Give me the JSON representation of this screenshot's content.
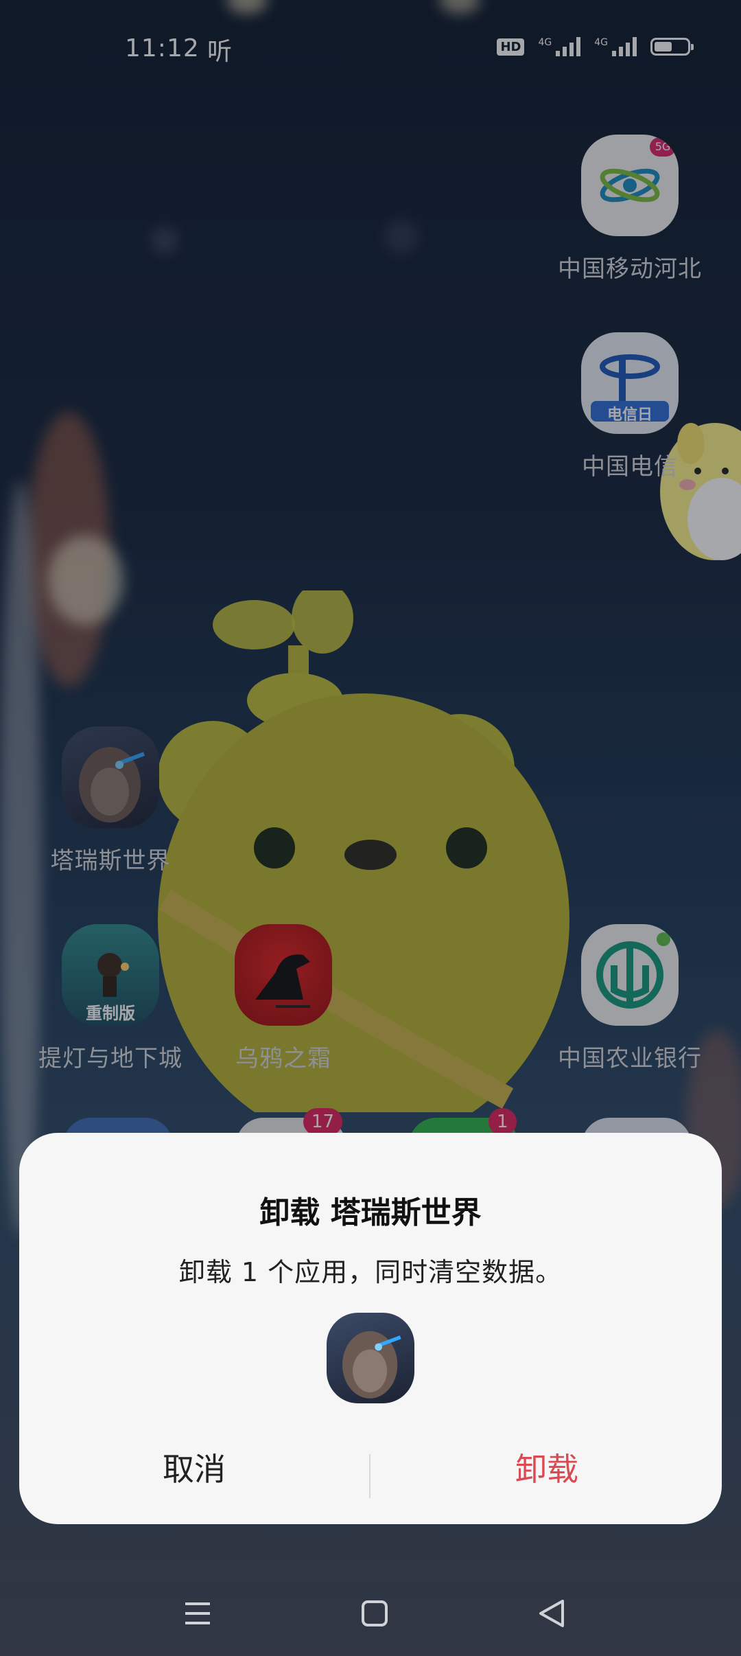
{
  "status_bar": {
    "time": "11:12",
    "extra_app_indicator": "听",
    "hd_label": "HD",
    "signal_1_label": "4G",
    "signal_2_label": "4G",
    "battery_level": 0.55
  },
  "home_apps": [
    {
      "label": "中国移动河北",
      "icon": "china-mobile-icon",
      "badge": "5G"
    },
    {
      "label": "中国电信",
      "icon": "china-telecom-icon",
      "icon_text": "电信日"
    },
    {
      "label": "塔瑞斯世界",
      "icon": "tarisland-icon"
    },
    {
      "label": "提灯与地下城",
      "icon": "lantern-dungeon-icon",
      "icon_text": "重制版"
    },
    {
      "label": "乌鸦之霜",
      "icon": "crow-frost-icon"
    },
    {
      "label": "中国农业银行",
      "icon": "abc-bank-icon"
    }
  ],
  "partial_row": {
    "badges": [
      "17",
      "1"
    ]
  },
  "dialog": {
    "title": "卸载 塔瑞斯世界",
    "message": "卸载 1 个应用，同时清空数据。",
    "app_icon": "tarisland-icon",
    "cancel_label": "取消",
    "confirm_label": "卸载"
  },
  "nav_bar": {
    "menu_icon": "menu-icon",
    "home_icon": "home-icon",
    "back_icon": "back-icon"
  },
  "colors": {
    "confirm": "#d94a52",
    "dialog_bg": "#f6f6f7"
  }
}
